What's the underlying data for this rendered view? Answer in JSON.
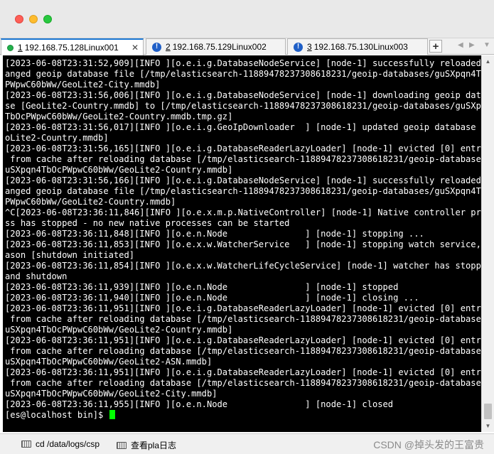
{
  "tabs": [
    {
      "num": "1",
      "label": "192.168.75.128Linux001",
      "status": "connected"
    },
    {
      "num": "2",
      "label": "192.168.75.129Linux002",
      "status": "warning"
    },
    {
      "num": "3",
      "label": "192.168.75.130Linux003",
      "status": "warning"
    }
  ],
  "add_tab_label": "+",
  "terminal": {
    "lines": [
      "[2023-06-08T23:31:52,909][INFO ][o.e.i.g.DatabaseNodeService] [node-1] successfully reloaded ch",
      "anged geoip database file [/tmp/elasticsearch-11889478237308618231/geoip-databases/guSXpqn4TbOc",
      "PWpwC60bWw/GeoLite2-City.mmdb]",
      "[2023-06-08T23:31:56,006][INFO ][o.e.i.g.DatabaseNodeService] [node-1] downloading geoip databa",
      "se [GeoLite2-Country.mmdb] to [/tmp/elasticsearch-11889478237308618231/geoip-databases/guSXpqn4",
      "TbOcPWpwC60bWw/GeoLite2-Country.mmdb.tmp.gz]",
      "[2023-06-08T23:31:56,017][INFO ][o.e.i.g.GeoIpDownloader  ] [node-1] updated geoip database [Ge",
      "oLite2-Country.mmdb]",
      "[2023-06-08T23:31:56,165][INFO ][o.e.i.g.DatabaseReaderLazyLoader] [node-1] evicted [0] entries",
      " from cache after reloading database [/tmp/elasticsearch-11889478237308618231/geoip-databases/g",
      "uSXpqn4TbOcPWpwC60bWw/GeoLite2-Country.mmdb]",
      "[2023-06-08T23:31:56,166][INFO ][o.e.i.g.DatabaseNodeService] [node-1] successfully reloaded ch",
      "anged geoip database file [/tmp/elasticsearch-11889478237308618231/geoip-databases/guSXpqn4TbOc",
      "PWpwC60bWw/GeoLite2-Country.mmdb]",
      "^C[2023-06-08T23:36:11,846][INFO ][o.e.x.m.p.NativeController] [node-1] Native controller proce",
      "ss has stopped - no new native processes can be started",
      "[2023-06-08T23:36:11,848][INFO ][o.e.n.Node               ] [node-1] stopping ...",
      "[2023-06-08T23:36:11,853][INFO ][o.e.x.w.WatcherService   ] [node-1] stopping watch service, re",
      "ason [shutdown initiated]",
      "[2023-06-08T23:36:11,854][INFO ][o.e.x.w.WatcherLifeCycleService] [node-1] watcher has stopped",
      "and shutdown",
      "[2023-06-08T23:36:11,939][INFO ][o.e.n.Node               ] [node-1] stopped",
      "[2023-06-08T23:36:11,940][INFO ][o.e.n.Node               ] [node-1] closing ...",
      "[2023-06-08T23:36:11,951][INFO ][o.e.i.g.DatabaseReaderLazyLoader] [node-1] evicted [0] entries",
      " from cache after reloading database [/tmp/elasticsearch-11889478237308618231/geoip-databases/g",
      "uSXpqn4TbOcPWpwC60bWw/GeoLite2-Country.mmdb]",
      "[2023-06-08T23:36:11,951][INFO ][o.e.i.g.DatabaseReaderLazyLoader] [node-1] evicted [0] entries",
      " from cache after reloading database [/tmp/elasticsearch-11889478237308618231/geoip-databases/g",
      "uSXpqn4TbOcPWpwC60bWw/GeoLite2-ASN.mmdb]",
      "[2023-06-08T23:36:11,951][INFO ][o.e.i.g.DatabaseReaderLazyLoader] [node-1] evicted [0] entries",
      " from cache after reloading database [/tmp/elasticsearch-11889478237308618231/geoip-databases/g",
      "uSXpqn4TbOcPWpwC60bWw/GeoLite2-City.mmdb]",
      "[2023-06-08T23:36:11,955][INFO ][o.e.n.Node               ] [node-1] closed"
    ],
    "prompt": "[es@localhost bin]$ "
  },
  "statusbar": {
    "items": [
      {
        "label": "cd /data/logs/csp"
      },
      {
        "label": "查看pla日志"
      }
    ],
    "watermark": "CSDN @掉头发的王富贵"
  },
  "colors": {
    "terminal_bg": "#000000",
    "terminal_fg": "#ffffff",
    "cursor": "#00ff00",
    "active_tab_accent": "#1a76d2"
  }
}
